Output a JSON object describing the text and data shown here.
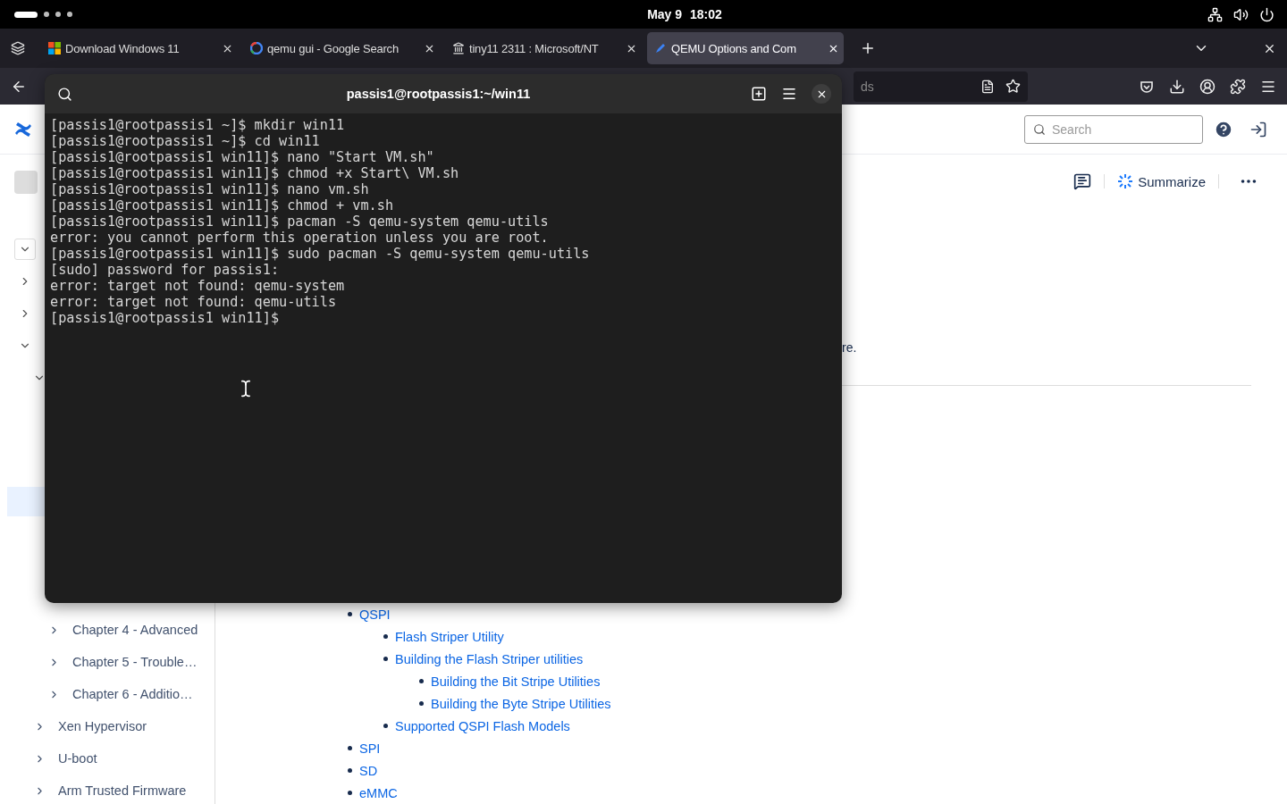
{
  "top_bar": {
    "date": "May 9",
    "time": "18:02"
  },
  "browser": {
    "tabs": [
      {
        "title": "Download Windows 11",
        "kind": "windows",
        "selected": false
      },
      {
        "title": "qemu gui - Google Search",
        "kind": "google",
        "selected": false
      },
      {
        "title": "tiny11 2311 : Microsoft/NT",
        "kind": "archive",
        "selected": false
      },
      {
        "title": "QEMU Options and Com",
        "kind": "docs",
        "selected": true
      }
    ],
    "url_text": "ds"
  },
  "page": {
    "search": {
      "placeholder": "Search"
    },
    "summarize": "Summarize",
    "partial_text": "re.",
    "sidebar": {
      "toggles": [
        {
          "expanded": true,
          "boxed": true
        },
        {
          "expanded": false,
          "boxed": false
        },
        {
          "expanded": false,
          "boxed": false
        },
        {
          "expanded": true,
          "boxed": false
        },
        {
          "expanded": true,
          "boxed": false
        }
      ],
      "subitems": [
        {
          "label": "Chapter 4 - Advanced"
        },
        {
          "label": "Chapter 5 - Trouble…"
        },
        {
          "label": "Chapter 6 - Additio…"
        }
      ],
      "items": [
        {
          "label": "Xen Hypervisor"
        },
        {
          "label": "U-boot"
        },
        {
          "label": "Arm Trusted Firmware"
        }
      ]
    },
    "links": [
      {
        "label": "QSPI",
        "children": [
          {
            "label": "Flash Striper Utility"
          },
          {
            "label": "Building the Flash Striper utilities",
            "children": [
              {
                "label": "Building the Bit Stripe Utilities"
              },
              {
                "label": "Building the Byte Stripe Utilities"
              }
            ]
          },
          {
            "label": "Supported QSPI Flash Models"
          }
        ]
      },
      {
        "label": "SPI"
      },
      {
        "label": "SD"
      },
      {
        "label": "eMMC"
      }
    ]
  },
  "terminal": {
    "title": "passis1@rootpassis1:~/win11",
    "lines": [
      "[passis1@rootpassis1 ~]$ mkdir win11",
      "[passis1@rootpassis1 ~]$ cd win11",
      "[passis1@rootpassis1 win11]$ nano \"Start VM.sh\"",
      "[passis1@rootpassis1 win11]$ chmod +x Start\\ VM.sh",
      "[passis1@rootpassis1 win11]$ nano vm.sh",
      "[passis1@rootpassis1 win11]$ chmod + vm.sh",
      "[passis1@rootpassis1 win11]$ pacman -S qemu-system qemu-utils",
      "error: you cannot perform this operation unless you are root.",
      "[passis1@rootpassis1 win11]$ sudo pacman -S qemu-system qemu-utils",
      "[sudo] password for passis1:",
      "error: target not found: qemu-system",
      "error: target not found: qemu-utils",
      "[passis1@rootpassis1 win11]$"
    ]
  }
}
